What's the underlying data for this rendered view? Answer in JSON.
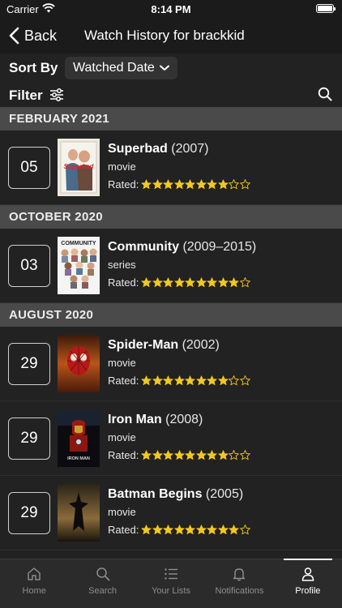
{
  "status_bar": {
    "carrier": "Carrier",
    "time": "8:14 PM"
  },
  "nav": {
    "back_label": "Back",
    "title": "Watch History for brackkid"
  },
  "sort": {
    "label": "Sort By",
    "value": "Watched Date"
  },
  "filter": {
    "label": "Filter"
  },
  "sections": [
    {
      "header": "FEBRUARY 2021",
      "items": [
        {
          "day": "05",
          "title": "Superbad",
          "year": "(2007)",
          "type": "movie",
          "rated_label": "Rated:",
          "rating": 8,
          "rating_max": 10
        }
      ]
    },
    {
      "header": "OCTOBER 2020",
      "items": [
        {
          "day": "03",
          "title": "Community",
          "year": "(2009–2015)",
          "type": "series",
          "rated_label": "Rated:",
          "rating": 9,
          "rating_max": 10
        }
      ]
    },
    {
      "header": "AUGUST 2020",
      "items": [
        {
          "day": "29",
          "title": "Spider-Man",
          "year": "(2002)",
          "type": "movie",
          "rated_label": "Rated:",
          "rating": 8,
          "rating_max": 10
        },
        {
          "day": "29",
          "title": "Iron Man",
          "year": "(2008)",
          "type": "movie",
          "rated_label": "Rated:",
          "rating": 8,
          "rating_max": 10
        },
        {
          "day": "29",
          "title": "Batman Begins",
          "year": "(2005)",
          "type": "movie",
          "rated_label": "Rated:",
          "rating": 9,
          "rating_max": 10
        }
      ]
    }
  ],
  "posters": [
    {
      "id": "superbad",
      "text": "Superbad"
    },
    {
      "id": "community",
      "text": "COMMUNITY"
    },
    {
      "id": "spiderman",
      "text": ""
    },
    {
      "id": "ironman",
      "text": "IRON MAN"
    },
    {
      "id": "batman",
      "text": ""
    }
  ],
  "tabs": [
    {
      "label": "Home",
      "icon": "home-icon",
      "active": false
    },
    {
      "label": "Search",
      "icon": "search-icon",
      "active": false
    },
    {
      "label": "Your Lists",
      "icon": "list-icon",
      "active": false
    },
    {
      "label": "Notifications",
      "icon": "bell-icon",
      "active": false
    },
    {
      "label": "Profile",
      "icon": "person-icon",
      "active": true
    }
  ],
  "colors": {
    "star": "#f2c81f",
    "section_header": "#4a4a4a",
    "background": "#222222",
    "tab_inactive": "#8e8e8e"
  }
}
